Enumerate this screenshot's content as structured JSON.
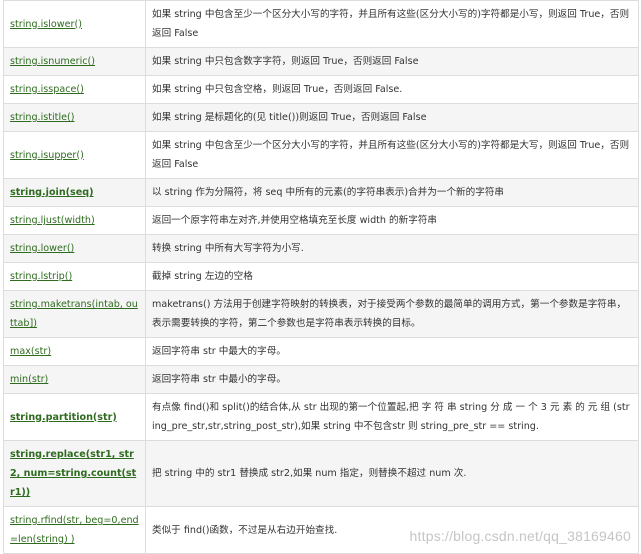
{
  "rows": [
    {
      "method": "string.islower()",
      "bold": false,
      "desc": "如果 string 中包含至少一个区分大小写的字符，并且所有这些(区分大小写的)字符都是小写，则返回 True，否则返回 False"
    },
    {
      "method": "string.isnumeric()",
      "bold": false,
      "desc": "如果 string 中只包含数字字符，则返回 True，否则返回 False"
    },
    {
      "method": "string.isspace()",
      "bold": false,
      "desc": "如果 string 中只包含空格，则返回 True，否则返回 False."
    },
    {
      "method": "string.istitle()",
      "bold": false,
      "desc": "如果 string 是标题化的(见 title())则返回 True，否则返回 False"
    },
    {
      "method": "string.isupper()",
      "bold": false,
      "desc": "如果 string 中包含至少一个区分大小写的字符，并且所有这些(区分大小写的)字符都是大写，则返回 True，否则返回 False"
    },
    {
      "method": "string.join(seq)",
      "bold": true,
      "desc": "以 string 作为分隔符，将 seq 中所有的元素(的字符串表示)合并为一个新的字符串"
    },
    {
      "method": "string.ljust(width)",
      "bold": false,
      "desc": "返回一个原字符串左对齐,并使用空格填充至长度 width 的新字符串"
    },
    {
      "method": "string.lower()",
      "bold": false,
      "desc": "转换 string 中所有大写字符为小写."
    },
    {
      "method": "string.lstrip()",
      "bold": false,
      "desc": "截掉 string 左边的空格"
    },
    {
      "method": "string.maketrans(intab, outtab])",
      "bold": false,
      "desc": "maketrans() 方法用于创建字符映射的转换表，对于接受两个参数的最简单的调用方式，第一个参数是字符串，表示需要转换的字符，第二个参数也是字符串表示转换的目标。"
    },
    {
      "method": "max(str)",
      "bold": false,
      "desc": "返回字符串 str 中最大的字母。"
    },
    {
      "method": "min(str)",
      "bold": false,
      "desc": "返回字符串 str 中最小的字母。"
    },
    {
      "method": "string.partition(str)",
      "bold": true,
      "desc": "有点像 find()和 split()的结合体,从 str 出现的第一个位置起,把 字 符 串 string 分 成 一 个 3 元 素 的 元 组 (string_pre_str,str,string_post_str),如果 string 中不包含str 则 string_pre_str == string."
    },
    {
      "method": "string.replace(str1, str2,  num=string.count(str1))",
      "bold": true,
      "desc": "把 string 中的 str1 替换成 str2,如果 num 指定，则替换不超过 num 次."
    },
    {
      "method": "string.rfind(str, beg=0,end=len(string) )",
      "bold": false,
      "desc": "类似于 find()函数，不过是从右边开始查找."
    }
  ],
  "watermark": "https://blog.csdn.net/qq_38169460"
}
